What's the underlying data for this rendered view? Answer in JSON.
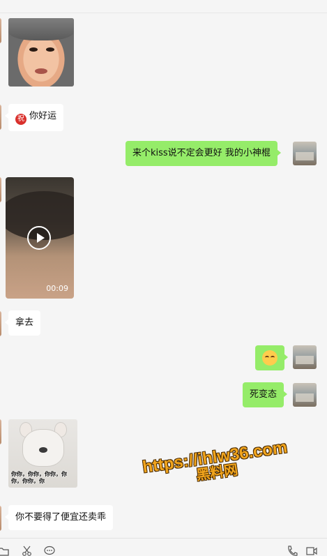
{
  "chat": {
    "messages": [
      {
        "side": "left",
        "type": "sticker",
        "icon": "crying-baby-sticker"
      },
      {
        "side": "left",
        "type": "text",
        "icon": "blessing-icon",
        "icon_glyph": "祝",
        "text": "你好运"
      },
      {
        "side": "right",
        "type": "text",
        "text": "来个kiss说不定会更好 我的小神棍"
      },
      {
        "side": "left",
        "type": "video",
        "duration": "00:09"
      },
      {
        "side": "left",
        "type": "text",
        "text": "拿去"
      },
      {
        "side": "right",
        "type": "emoji",
        "icon": "smiling-face-emoji"
      },
      {
        "side": "right",
        "type": "text",
        "text": "死变态"
      },
      {
        "side": "left",
        "type": "sticker",
        "icon": "french-bulldog-sticker",
        "caption": "你你，你你，你你，你你，你你，你"
      },
      {
        "side": "left",
        "type": "text",
        "text": "你不要得了便宜还卖乖"
      }
    ]
  },
  "watermark": {
    "line1": "https://ihlw36.com",
    "line2": "黑料网"
  },
  "toolbar": {
    "left_icons": [
      "folder-icon",
      "scissors-icon",
      "chat-bubble-icon"
    ],
    "right_icons": [
      "phone-icon",
      "video-call-icon"
    ]
  },
  "colors": {
    "background": "#f5f5f5",
    "outgoing_bubble": "#95ec69",
    "incoming_bubble": "#ffffff",
    "watermark": "#f2a51d"
  }
}
